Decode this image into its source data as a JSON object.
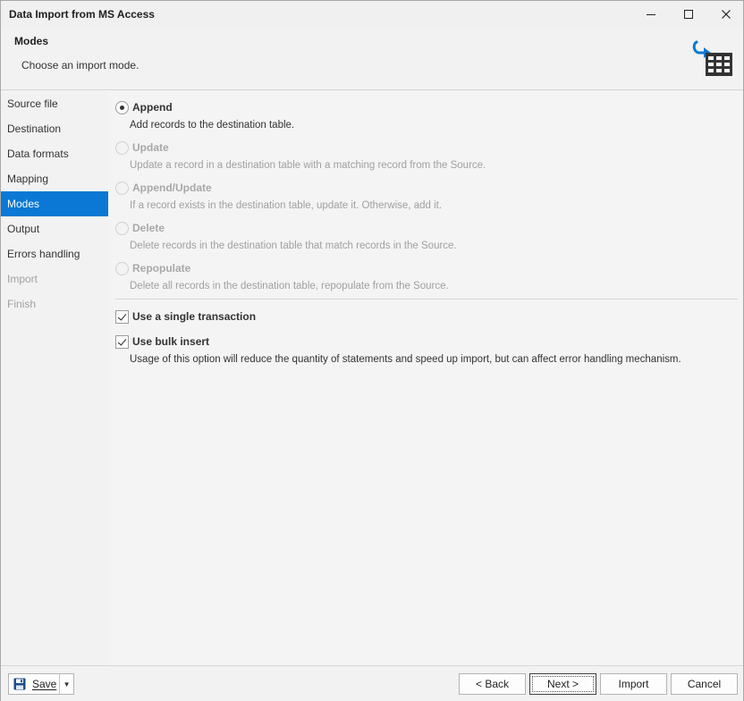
{
  "window": {
    "title": "Data Import from MS Access",
    "minimize_glyph": "—",
    "maximize_glyph": "☐",
    "close_glyph": "✕"
  },
  "header": {
    "title": "Modes",
    "subtitle": "Choose an import mode.",
    "icon": "import-table-icon"
  },
  "sidebar": {
    "items": [
      {
        "label": "Source file",
        "state": "normal"
      },
      {
        "label": "Destination",
        "state": "normal"
      },
      {
        "label": "Data formats",
        "state": "normal"
      },
      {
        "label": "Mapping",
        "state": "normal"
      },
      {
        "label": "Modes",
        "state": "active"
      },
      {
        "label": "Output",
        "state": "normal"
      },
      {
        "label": "Errors handling",
        "state": "normal"
      },
      {
        "label": "Import",
        "state": "disabled"
      },
      {
        "label": "Finish",
        "state": "disabled"
      }
    ]
  },
  "modes": [
    {
      "label": "Append",
      "description": "Add records to the destination table.",
      "selected": true,
      "enabled": true
    },
    {
      "label": "Update",
      "description": "Update a record in a destination table with a matching record from the Source.",
      "selected": false,
      "enabled": false
    },
    {
      "label": "Append/Update",
      "description": "If a record exists in the destination table, update it. Otherwise, add it.",
      "selected": false,
      "enabled": false
    },
    {
      "label": "Delete",
      "description": "Delete records in the destination table that match records in the Source.",
      "selected": false,
      "enabled": false
    },
    {
      "label": "Repopulate",
      "description": "Delete all records in the destination table, repopulate from the Source.",
      "selected": false,
      "enabled": false
    }
  ],
  "options": {
    "single_transaction": {
      "label": "Use a single transaction",
      "checked": true
    },
    "bulk_insert": {
      "label": "Use bulk insert",
      "checked": true,
      "description": "Usage of this option will reduce the quantity of statements and speed up import, but can affect error handling mechanism."
    }
  },
  "footer": {
    "save_label": "Save",
    "back_label": "< Back",
    "next_label": "Next >",
    "import_label": "Import",
    "cancel_label": "Cancel"
  },
  "colors": {
    "accent": "#0a78d4",
    "icon_dark": "#333333"
  }
}
